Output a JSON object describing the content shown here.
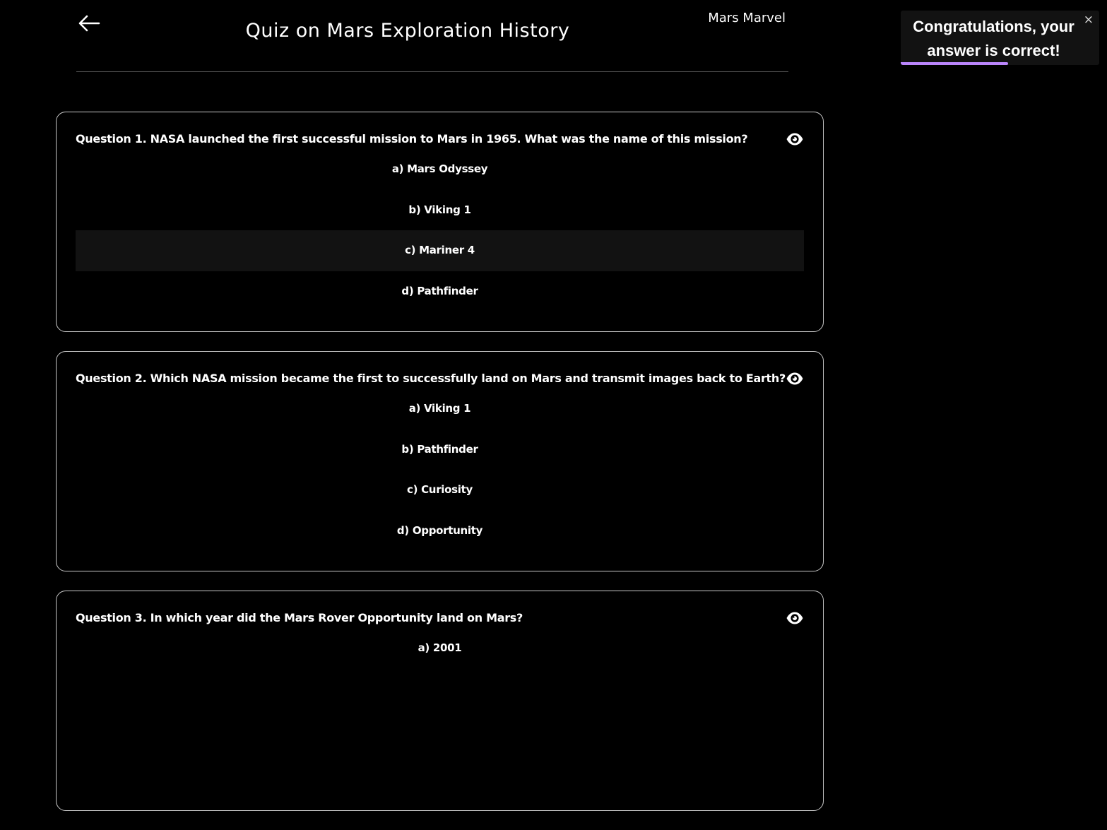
{
  "header": {
    "back_icon": "arrow-left-icon",
    "title": "Quiz on Mars Exploration History",
    "brand": "Mars Marvel"
  },
  "questions": [
    {
      "text": "Question 1. NASA launched the first successful mission to Mars in 1965. What was the name of this mission?",
      "reveal_icon": "eye-icon",
      "options": [
        "a) Mars Odyssey",
        "b) Viking 1",
        "c) Mariner 4",
        "d) Pathfinder"
      ],
      "selected_index": 2
    },
    {
      "text": "Question 2. Which NASA mission became the first to successfully land on Mars and transmit images back to Earth?",
      "reveal_icon": "eye-icon",
      "options": [
        "a) Viking 1",
        "b) Pathfinder",
        "c) Curiosity",
        "d) Opportunity"
      ],
      "selected_index": null
    },
    {
      "text": "Question 3. In which year did the Mars Rover Opportunity land on Mars?",
      "reveal_icon": "eye-icon",
      "options": [
        "a) 2001"
      ],
      "selected_index": null
    }
  ],
  "toast": {
    "message": "Congratulations, your answer is correct!",
    "close_label": "×",
    "progress_fraction": 0.54,
    "progress_color": "#bb86fc"
  },
  "colors": {
    "background": "#000000",
    "selected_option": "#121212",
    "card_border": "#c8c8c8"
  }
}
